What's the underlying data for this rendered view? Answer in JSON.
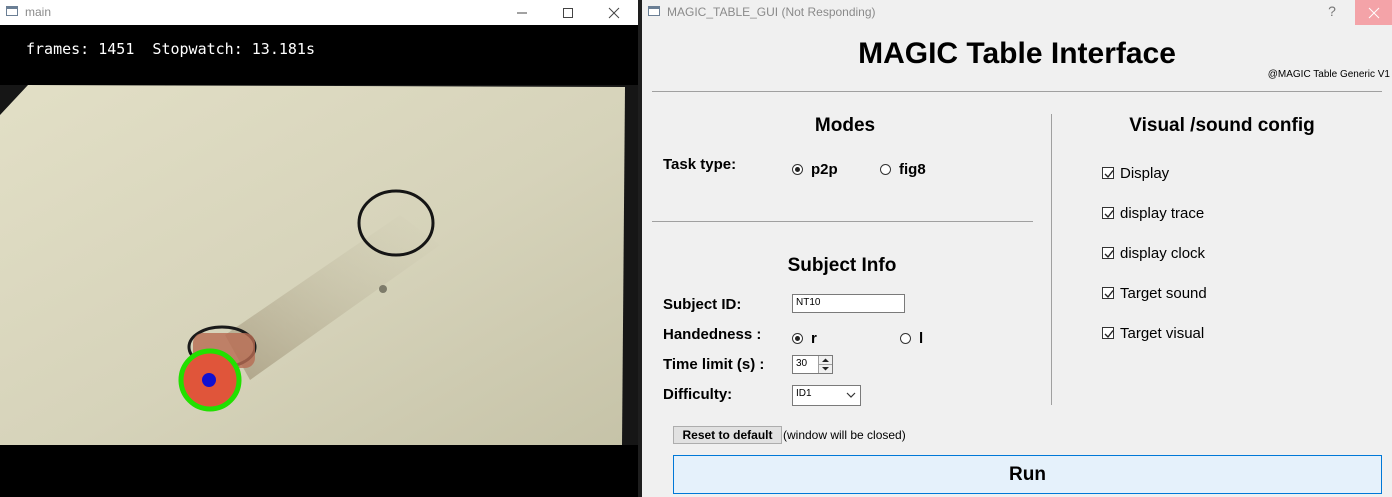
{
  "main_window": {
    "title": "main",
    "overlay": "frames: 1451  Stopwatch: 13.181s"
  },
  "gui_window": {
    "title": "MAGIC_TABLE_GUI (Not Responding)",
    "help": "?",
    "heading": "MAGIC Table Interface",
    "subheading": "@MAGIC Table Generic V1",
    "modes": {
      "title": "Modes",
      "task_type_label": "Task type:",
      "options": [
        "p2p",
        "fig8"
      ],
      "selected": "p2p"
    },
    "subject_info": {
      "title": "Subject Info",
      "subject_id_label": "Subject ID:",
      "subject_id_value": "NT10",
      "handedness_label": "Handedness :",
      "handedness_options": [
        "r",
        "l"
      ],
      "handedness_selected": "r",
      "time_limit_label": "Time limit (s) :",
      "time_limit_value": "30",
      "difficulty_label": "Difficulty:",
      "difficulty_value": "ID1"
    },
    "visual_sound": {
      "title": "Visual /sound config",
      "checkboxes": [
        {
          "label": "Display",
          "checked": true
        },
        {
          "label": "display trace",
          "checked": true
        },
        {
          "label": "display clock",
          "checked": true
        },
        {
          "label": "Target sound",
          "checked": true
        },
        {
          "label": "Target visual",
          "checked": true
        }
      ]
    },
    "reset_button": "Reset to default",
    "reset_note": "(window will be closed)",
    "run_button": "Run"
  },
  "colors": {
    "tracker_ring": "#22e000",
    "tracker_dot": "#1010d0",
    "target_marker": "#e4573d",
    "paper": "#dcd9c0",
    "run_border": "#0078d7",
    "run_fill": "#e5f1fb"
  }
}
